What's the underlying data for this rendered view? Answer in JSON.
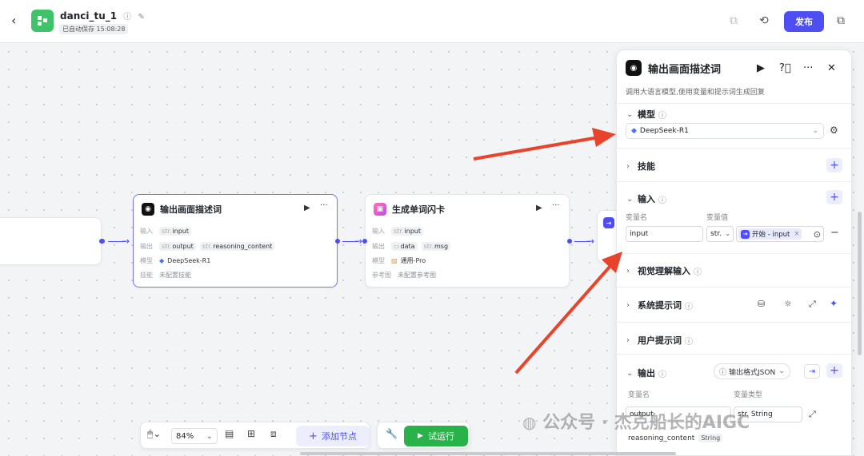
{
  "header": {
    "app_name": "danci_tu_1",
    "saved_status": "已自动保存 15:08:28",
    "publish_label": "发布"
  },
  "nodes": [
    {
      "title": "输出画面描述词",
      "input_label": "输入",
      "inputs": [
        {
          "type": "str.",
          "name": "input"
        }
      ],
      "output_label": "输出",
      "outputs": [
        {
          "type": "str.",
          "name": "output"
        },
        {
          "type": "str.",
          "name": "reasoning_content"
        }
      ],
      "model_label": "模型",
      "model": "DeepSeek-R1",
      "skill_label": "技能",
      "skill_value": "未配置技能"
    },
    {
      "title": "生成单词闪卡",
      "input_label": "输入",
      "inputs": [
        {
          "type": "str.",
          "name": "input"
        }
      ],
      "output_label": "输出",
      "outputs": [
        {
          "type": "",
          "name": "data"
        },
        {
          "type": "str.",
          "name": "msg"
        }
      ],
      "model_label": "模型",
      "model": "通用-Pro",
      "ref_label": "参考图",
      "ref_value": "未配置参考图"
    }
  ],
  "panel": {
    "title": "输出画面描述词",
    "description": "调用大语言模型,使用变量和提示词生成回复",
    "sections": {
      "model": {
        "label": "模型",
        "value": "DeepSeek-R1"
      },
      "skills": {
        "label": "技能"
      },
      "input": {
        "label": "输入",
        "col_name": "变量名",
        "col_value": "变量值",
        "var_name": "input",
        "var_type": "str.",
        "ref_tag": "开始 - input"
      },
      "vision": {
        "label": "视觉理解输入"
      },
      "system_prompt": {
        "label": "系统提示词"
      },
      "user_prompt": {
        "label": "用户提示词"
      },
      "output": {
        "label": "输出",
        "format_label": "输出格式JSON",
        "col_name": "变量名",
        "col_type": "变量类型",
        "var1_name": "output",
        "var1_type": "str. String",
        "var2_name": "reasoning_content",
        "var2_type": "String"
      }
    }
  },
  "bottom_toolbar": {
    "zoom": "84%",
    "add_node_label": "添加节点",
    "run_label": "试运行"
  },
  "watermark": "公众号 · 杰克船长的AIGC",
  "colors": {
    "accent": "#4e4ef2",
    "run_green": "#29b24a",
    "annotation_red": "#e8432c"
  }
}
